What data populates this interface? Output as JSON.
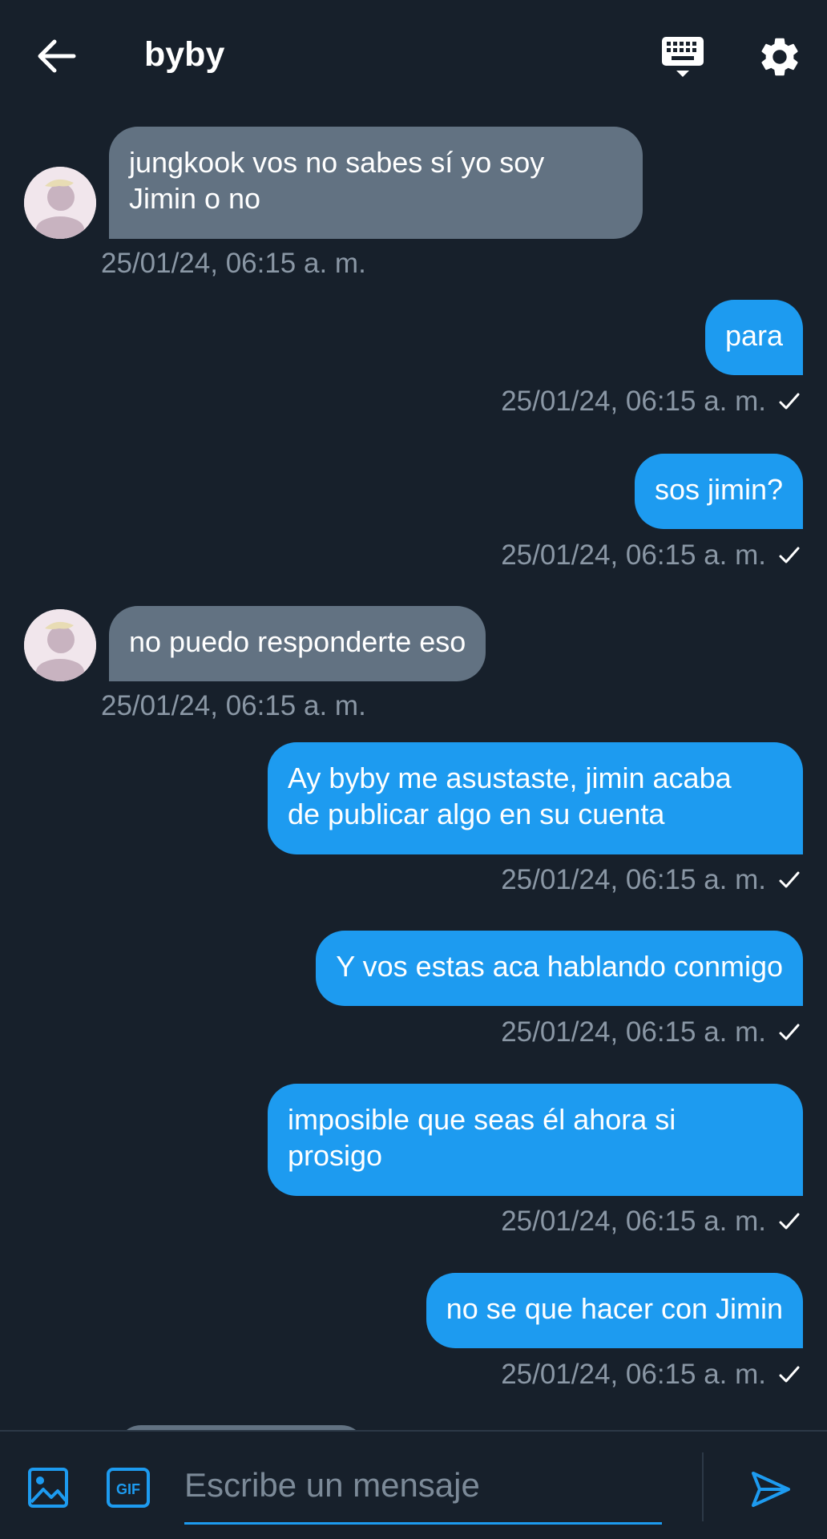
{
  "header": {
    "title": "byby",
    "back_icon": "arrow-left-icon",
    "keyboard_icon": "keyboard-icon",
    "settings_icon": "gear-icon"
  },
  "messages": [
    {
      "direction": "in",
      "text": "jungkook vos no sabes sí yo soy\nJimin o no",
      "timestamp": "25/01/24, 06:15 a. m."
    },
    {
      "direction": "out",
      "text": "para",
      "timestamp": "25/01/24, 06:15 a. m.",
      "status": "sent-check-icon"
    },
    {
      "direction": "out",
      "text": "sos jimin?",
      "timestamp": "25/01/24, 06:15 a. m.",
      "status": "sent-check-icon"
    },
    {
      "direction": "in",
      "text": "no puedo responderte eso",
      "timestamp": "25/01/24, 06:15 a. m."
    },
    {
      "direction": "out",
      "text": "Ay byby me asustaste, jimin acaba\nde publicar algo en su cuenta",
      "timestamp": "25/01/24, 06:15 a. m.",
      "status": "sent-check-icon"
    },
    {
      "direction": "out",
      "text": "Y vos estas aca hablando conmigo",
      "timestamp": "25/01/24, 06:15 a. m.",
      "status": "sent-check-icon"
    },
    {
      "direction": "out",
      "text": "imposible que seas él ahora si\nprosigo",
      "timestamp": "25/01/24, 06:15 a. m.",
      "status": "sent-check-icon"
    },
    {
      "direction": "out",
      "text": "no se que hacer con Jimin",
      "timestamp": "25/01/24, 06:15 a. m.",
      "status": "sent-check-icon"
    }
  ],
  "composer": {
    "placeholder": "Escribe un mensaje",
    "value": "",
    "image_icon": "image-icon",
    "gif_icon": "gif-icon",
    "send_icon": "send-icon"
  },
  "colors": {
    "background": "#17202b",
    "incoming_bubble": "#627282",
    "outgoing_bubble": "#1d9bf0",
    "timestamp": "#8a97a5",
    "accent": "#1d9bf0"
  }
}
